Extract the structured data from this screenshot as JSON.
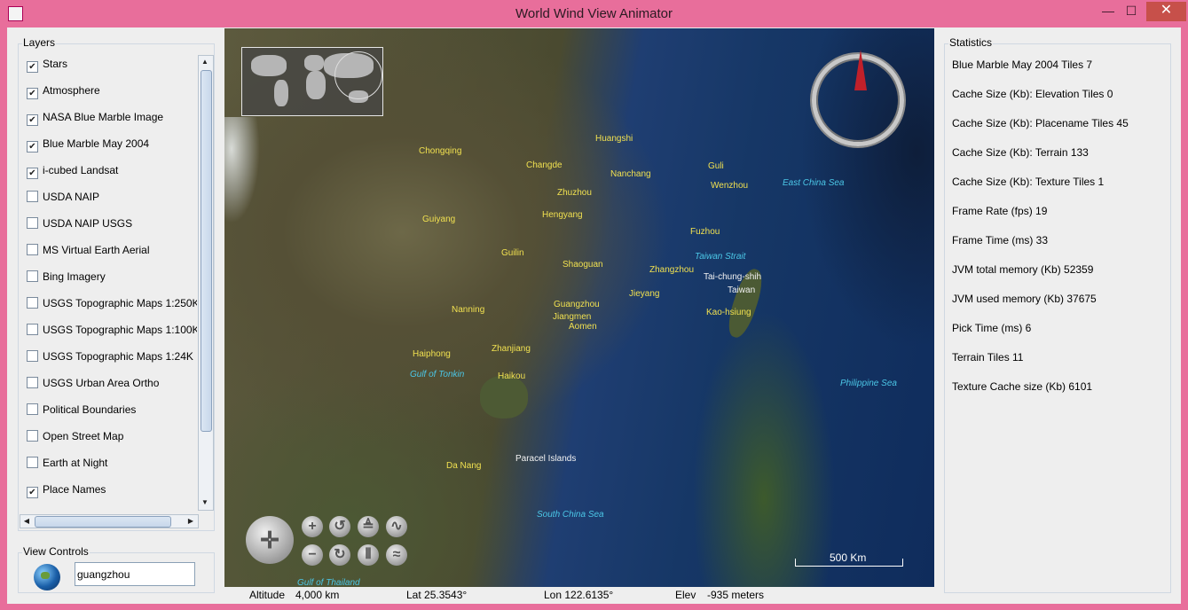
{
  "window": {
    "title": "World Wind View Animator",
    "minimize": "—",
    "maximize": "☐",
    "close": "✕"
  },
  "layers": {
    "title": "Layers",
    "items": [
      {
        "label": "Stars",
        "checked": true
      },
      {
        "label": "Atmosphere",
        "checked": true
      },
      {
        "label": "NASA Blue Marble Image",
        "checked": true
      },
      {
        "label": "Blue Marble May 2004",
        "checked": true
      },
      {
        "label": "i-cubed Landsat",
        "checked": true
      },
      {
        "label": "USDA NAIP",
        "checked": false
      },
      {
        "label": "USDA NAIP USGS",
        "checked": false
      },
      {
        "label": "MS Virtual Earth Aerial",
        "checked": false
      },
      {
        "label": "Bing Imagery",
        "checked": false
      },
      {
        "label": "USGS Topographic Maps 1:250K",
        "checked": false
      },
      {
        "label": "USGS Topographic Maps 1:100K",
        "checked": false
      },
      {
        "label": "USGS Topographic Maps 1:24K",
        "checked": false
      },
      {
        "label": "USGS Urban Area Ortho",
        "checked": false
      },
      {
        "label": "Political Boundaries",
        "checked": false
      },
      {
        "label": "Open Street Map",
        "checked": false
      },
      {
        "label": "Earth at Night",
        "checked": false
      },
      {
        "label": "Place Names",
        "checked": true
      }
    ]
  },
  "view_controls": {
    "title": "View Controls",
    "search_value": "guangzhou"
  },
  "map": {
    "places": [
      {
        "name": "Huangshi",
        "kind": "city"
      },
      {
        "name": "Chongqing",
        "kind": "city"
      },
      {
        "name": "Changde",
        "kind": "city"
      },
      {
        "name": "Nanchang",
        "kind": "city"
      },
      {
        "name": "Guli",
        "kind": "city"
      },
      {
        "name": "Wenzhou",
        "kind": "city"
      },
      {
        "name": "East China Sea",
        "kind": "water"
      },
      {
        "name": "Zhuzhou",
        "kind": "city"
      },
      {
        "name": "Hengyang",
        "kind": "city"
      },
      {
        "name": "Guiyang",
        "kind": "city"
      },
      {
        "name": "Fuzhou",
        "kind": "city"
      },
      {
        "name": "Guilin",
        "kind": "city"
      },
      {
        "name": "Taiwan Strait",
        "kind": "water"
      },
      {
        "name": "Shaoguan",
        "kind": "city"
      },
      {
        "name": "Zhangzhou",
        "kind": "city"
      },
      {
        "name": "Tai-chung-shih",
        "kind": "white"
      },
      {
        "name": "Taiwan",
        "kind": "white"
      },
      {
        "name": "Jieyang",
        "kind": "city"
      },
      {
        "name": "Guangzhou",
        "kind": "city"
      },
      {
        "name": "Nanning",
        "kind": "city"
      },
      {
        "name": "Jiangmen",
        "kind": "city"
      },
      {
        "name": "Kao-hsiung",
        "kind": "city"
      },
      {
        "name": "Aomen",
        "kind": "city"
      },
      {
        "name": "Haiphong",
        "kind": "city"
      },
      {
        "name": "Zhanjiang",
        "kind": "city"
      },
      {
        "name": "Gulf of Tonkin",
        "kind": "water"
      },
      {
        "name": "Haikou",
        "kind": "city"
      },
      {
        "name": "Philippine Sea",
        "kind": "water"
      },
      {
        "name": "Da Nang",
        "kind": "city"
      },
      {
        "name": "Paracel Islands",
        "kind": "white"
      },
      {
        "name": "South China Sea",
        "kind": "water"
      },
      {
        "name": "Gulf of Thailand",
        "kind": "water"
      }
    ],
    "scale_label": "500 Km"
  },
  "status_bar": {
    "altitude_label": "Altitude",
    "altitude_value": "4,000 km",
    "lat": "Lat 25.3543°",
    "lon": "Lon 122.6135°",
    "elev_label": "Elev",
    "elev_value": "-935 meters"
  },
  "statistics": {
    "title": "Statistics",
    "items": [
      "Blue Marble May 2004 Tiles 7",
      "Cache Size (Kb): Elevation Tiles 0",
      "Cache Size (Kb): Placename Tiles 45",
      "Cache Size (Kb): Terrain 133",
      "Cache Size (Kb): Texture Tiles 1",
      "Frame Rate (fps) 19",
      "Frame Time (ms) 33",
      "JVM total memory (Kb) 52359",
      "JVM used memory (Kb) 37675",
      "Pick Time (ms) 6",
      "Terrain Tiles 11",
      "Texture Cache size (Kb) 6101"
    ]
  }
}
